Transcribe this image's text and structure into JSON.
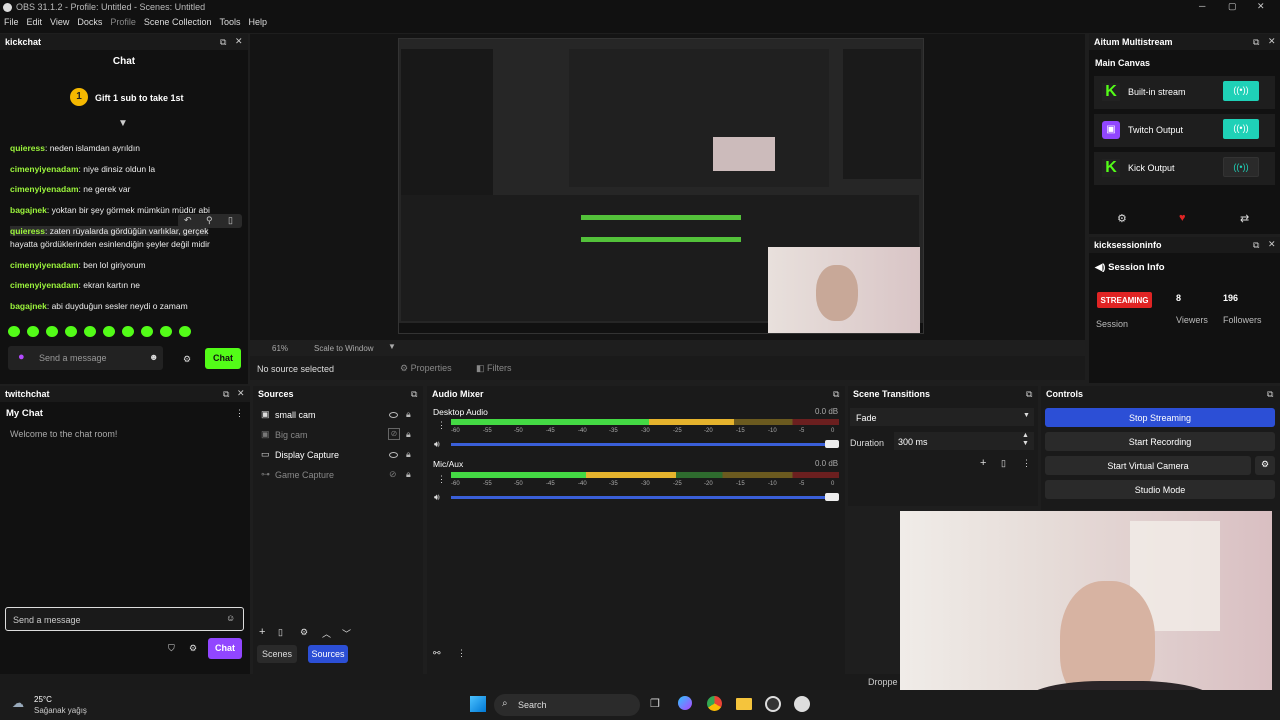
{
  "window": {
    "title": "OBS 31.1.2 - Profile: Untitled - Scenes: Untitled"
  },
  "menu": [
    "File",
    "Edit",
    "View",
    "Docks",
    "Profile",
    "Scene Collection",
    "Tools",
    "Help"
  ],
  "kickchat": {
    "dock_title": "kickchat",
    "header": "Chat",
    "gift_badge": "1",
    "gift_text": "Gift 1 sub to take 1st",
    "messages": [
      {
        "user": "quieress",
        "text": ": neden islamdan ayrıldın"
      },
      {
        "user": "cimenyiyenadam",
        "text": ": niye dinsiz oldun la"
      },
      {
        "user": "cimenyiyenadam",
        "text": ": ne gerek var"
      },
      {
        "user": "bagajnek",
        "text": ": yoktan bir şey görmek mümkün müdür abi"
      },
      {
        "user": "quieress",
        "text": ": zaten rüyalarda gördüğün varlıklar, gerçek"
      },
      {
        "user": "",
        "text": "hayatta gördüklerinden esinlendiğin şeyler değil midir"
      },
      {
        "user": "cimenyiyenadam",
        "text": ": ben lol giriyorum"
      },
      {
        "user": "cimenyiyenadam",
        "text": ": ekran kartın ne"
      },
      {
        "user": "bagajnek",
        "text": ": abi duyduğun sesler neydi o zamam"
      }
    ],
    "input_placeholder": "Send a message",
    "chat_button": "Chat"
  },
  "preview": {
    "zoom": "61%",
    "zoom_mode": "Scale to Window",
    "no_source": "No source selected",
    "properties": "Properties",
    "filters": "Filters"
  },
  "multistream": {
    "dock_title": "Aitum Multistream",
    "canvas": "Main Canvas",
    "outputs": [
      {
        "name": "Built-in stream",
        "active": true
      },
      {
        "name": "Twitch Output",
        "active": true
      },
      {
        "name": "Kick Output",
        "active": false
      }
    ]
  },
  "kicksession": {
    "dock_title": "kicksessioninfo",
    "header": "Session Info",
    "status": "STREAMING",
    "session_label": "Session",
    "viewers": "8",
    "viewers_label": "Viewers",
    "followers": "196",
    "followers_label": "Followers"
  },
  "twitchchat": {
    "dock_title": "twitchchat",
    "header": "My Chat",
    "welcome": "Welcome to the chat room!",
    "input_placeholder": "Send a message",
    "chat_button": "Chat"
  },
  "sources": {
    "title": "Sources",
    "items": [
      {
        "name": "small cam",
        "visible": true
      },
      {
        "name": "Big cam",
        "visible": false
      },
      {
        "name": "Display Capture",
        "visible": true
      },
      {
        "name": "Game Capture",
        "visible": false
      }
    ],
    "tab_scenes": "Scenes",
    "tab_sources": "Sources"
  },
  "mixer": {
    "title": "Audio Mixer",
    "channels": [
      {
        "name": "Desktop Audio",
        "db": "0.0 dB",
        "level": 0.73
      },
      {
        "name": "Mic/Aux",
        "db": "0.0 dB",
        "level": 0.58
      }
    ],
    "scale": [
      "-60",
      "-55",
      "-50",
      "-45",
      "-40",
      "-35",
      "-30",
      "-25",
      "-20",
      "-15",
      "-10",
      "-5",
      "0"
    ]
  },
  "transitions": {
    "title": "Scene Transitions",
    "selected": "Fade",
    "duration_label": "Duration",
    "duration": "300 ms"
  },
  "controls": {
    "title": "Controls",
    "stop_streaming": "Stop Streaming",
    "start_recording": "Start Recording",
    "start_virtual_camera": "Start Virtual Camera",
    "studio_mode": "Studio Mode"
  },
  "status": {
    "dropped": "Droppe"
  },
  "taskbar": {
    "temp": "25°C",
    "weather": "Sağanak yağış",
    "search": "Search"
  },
  "colors": {
    "accent_green": "#53fc18",
    "stream_blue": "#2c4fd6",
    "twitch_purple": "#9146ff",
    "streaming_red": "#e02424",
    "toggle_teal": "#1fd1b7"
  }
}
